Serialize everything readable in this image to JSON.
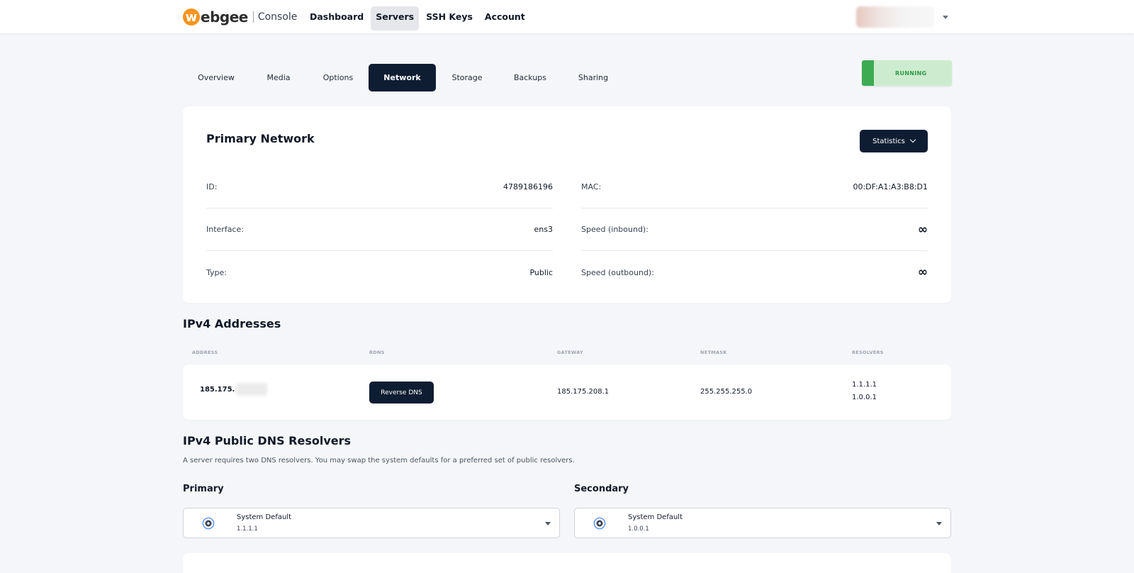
{
  "header": {
    "logo_mark": "w",
    "logo_text": "ebgee",
    "logo_sub": "Console",
    "nav": [
      "Dashboard",
      "Servers",
      "SSH Keys",
      "Account"
    ],
    "active_nav": "Servers"
  },
  "tabs": [
    "Overview",
    "Media",
    "Options",
    "Network",
    "Storage",
    "Backups",
    "Sharing"
  ],
  "active_tab": "Network",
  "status": "RUNNING",
  "colors": {
    "accent_dark": "#0f1d33",
    "status_green": "#3cab52",
    "logo_orange": "#f7941d"
  },
  "primary_network": {
    "title": "Primary Network",
    "statistics_label": "Statistics",
    "left": [
      {
        "key": "ID:",
        "value": "4789186196"
      },
      {
        "key": "Interface:",
        "value": "ens3"
      },
      {
        "key": "Type:",
        "value": "Public"
      }
    ],
    "right": [
      {
        "key": "MAC:",
        "value": "00:DF:A1:A3:B8:D1"
      },
      {
        "key": "Speed (inbound):",
        "value": "∞"
      },
      {
        "key": "Speed (outbound):",
        "value": "∞"
      }
    ]
  },
  "ipv4": {
    "title": "IPv4 Addresses",
    "columns": [
      "ADDRESS",
      "RDNS",
      "GATEWAY",
      "NETMASK",
      "RESOLVERS"
    ],
    "row": {
      "address": "185.175.",
      "rdns_button": "Reverse DNS",
      "gateway": "185.175.208.1",
      "netmask": "255.255.255.0",
      "resolvers": [
        "1.1.1.1",
        "1.0.0.1"
      ]
    }
  },
  "dns": {
    "title": "IPv4 Public DNS Resolvers",
    "description": "A server requires two DNS resolvers. You may swap the system defaults for a preferred set of public resolvers.",
    "primary": {
      "label": "Primary",
      "value": "System Default",
      "sub": "1.1.1.1",
      "icon": "gear-icon"
    },
    "secondary": {
      "label": "Secondary",
      "value": "System Default",
      "sub": "1.0.0.1",
      "icon": "gear-icon"
    }
  }
}
